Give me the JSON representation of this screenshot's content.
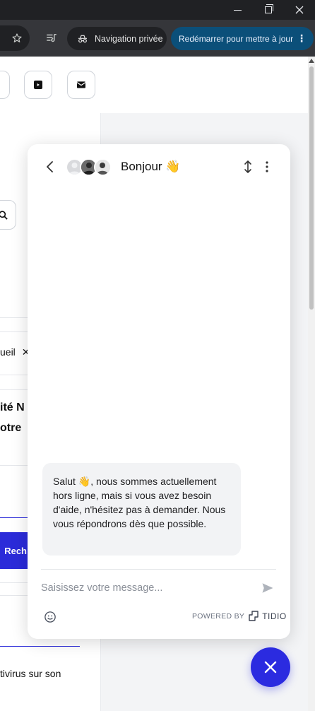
{
  "browser": {
    "incognito_label": "Navigation privée",
    "update_label": "Redémarrer pour mettre à jour"
  },
  "page": {
    "breadcrumb_fragment": "ueil",
    "breadcrumb_close": "✕",
    "heading_line1": "ité N",
    "heading_line2": "otre",
    "button_fragment": "Rech",
    "footer_text": "tivirus sur son"
  },
  "chat": {
    "title": "Bonjour",
    "title_emoji": "👋",
    "message_greeting": "Salut",
    "message_emoji": "👋",
    "message_body": ", nous sommes actuellement hors ligne, mais si vous avez besoin d'aide, n'hésitez pas à demander. Nous vous répondrons dès que possible.",
    "composer_placeholder": "Saisissez votre message...",
    "powered_by": "POWERED BY",
    "brand": "TIDIO"
  },
  "colors": {
    "accent": "#2b2be0",
    "update_pill": "#0b4f79"
  }
}
